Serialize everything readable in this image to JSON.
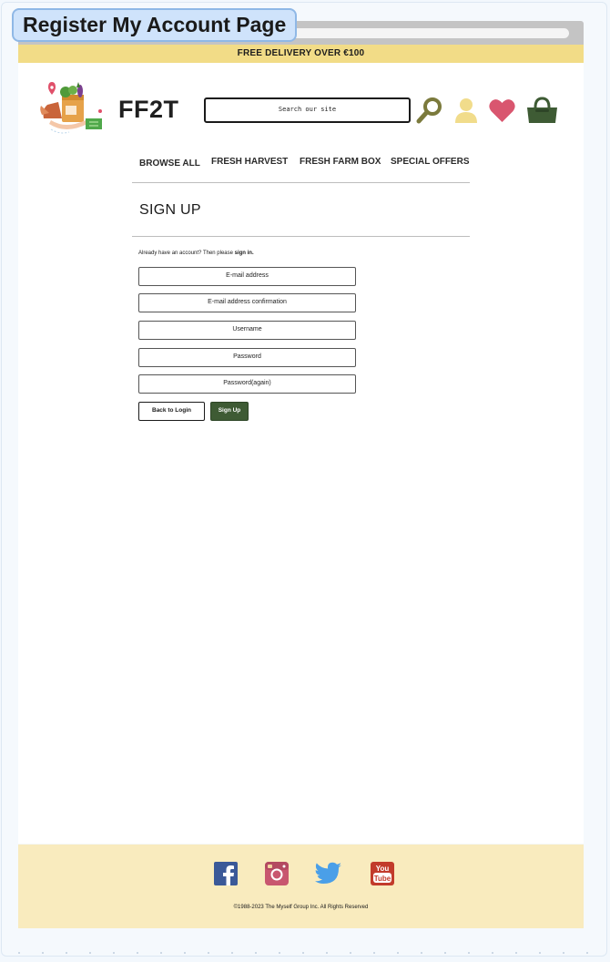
{
  "page_label": "Register My Account Page",
  "promo_banner": "FREE DELIVERY OVER €100",
  "brand": {
    "name": "FF2T",
    "logo_icon": "grocery-bag-delivery-icon"
  },
  "search": {
    "placeholder": "Search our site",
    "icon": "magnifier-icon"
  },
  "header_icons": [
    {
      "name": "account-icon",
      "color": "#f1dc8b"
    },
    {
      "name": "wishlist-heart-icon",
      "color": "#d9566f"
    },
    {
      "name": "basket-icon",
      "color": "#3e5b34"
    }
  ],
  "nav": {
    "items": [
      {
        "label": "BROWSE ALL"
      },
      {
        "label": "FRESH HARVEST"
      },
      {
        "label": "FRESH FARM BOX"
      },
      {
        "label": "SPECIAL OFFERS"
      }
    ]
  },
  "signup": {
    "title": "SIGN UP",
    "already_prefix": "Already have an account? Then please ",
    "already_link": "sign in.",
    "fields": [
      {
        "placeholder": "E-mail address"
      },
      {
        "placeholder": "E-mail address confirmation"
      },
      {
        "placeholder": "Username"
      },
      {
        "placeholder": "Password"
      },
      {
        "placeholder": "Password(again)"
      }
    ],
    "back_button": "Back to Login",
    "submit_button": "Sign Up"
  },
  "footer": {
    "social": [
      {
        "name": "facebook-icon",
        "color": "#3b5998"
      },
      {
        "name": "instagram-icon",
        "color": "#c8566f"
      },
      {
        "name": "twitter-icon",
        "color": "#4a9fe8"
      },
      {
        "name": "youtube-icon",
        "color": "#c23b2b"
      }
    ],
    "copyright": "©1988-2023 The Myself Group Inc. All Rights Reserved"
  },
  "colors": {
    "promo_bg": "#f2dc87",
    "footer_bg": "#f9ebbe",
    "accent_green": "#3e5b34",
    "search_icon": "#7b7a3c"
  }
}
